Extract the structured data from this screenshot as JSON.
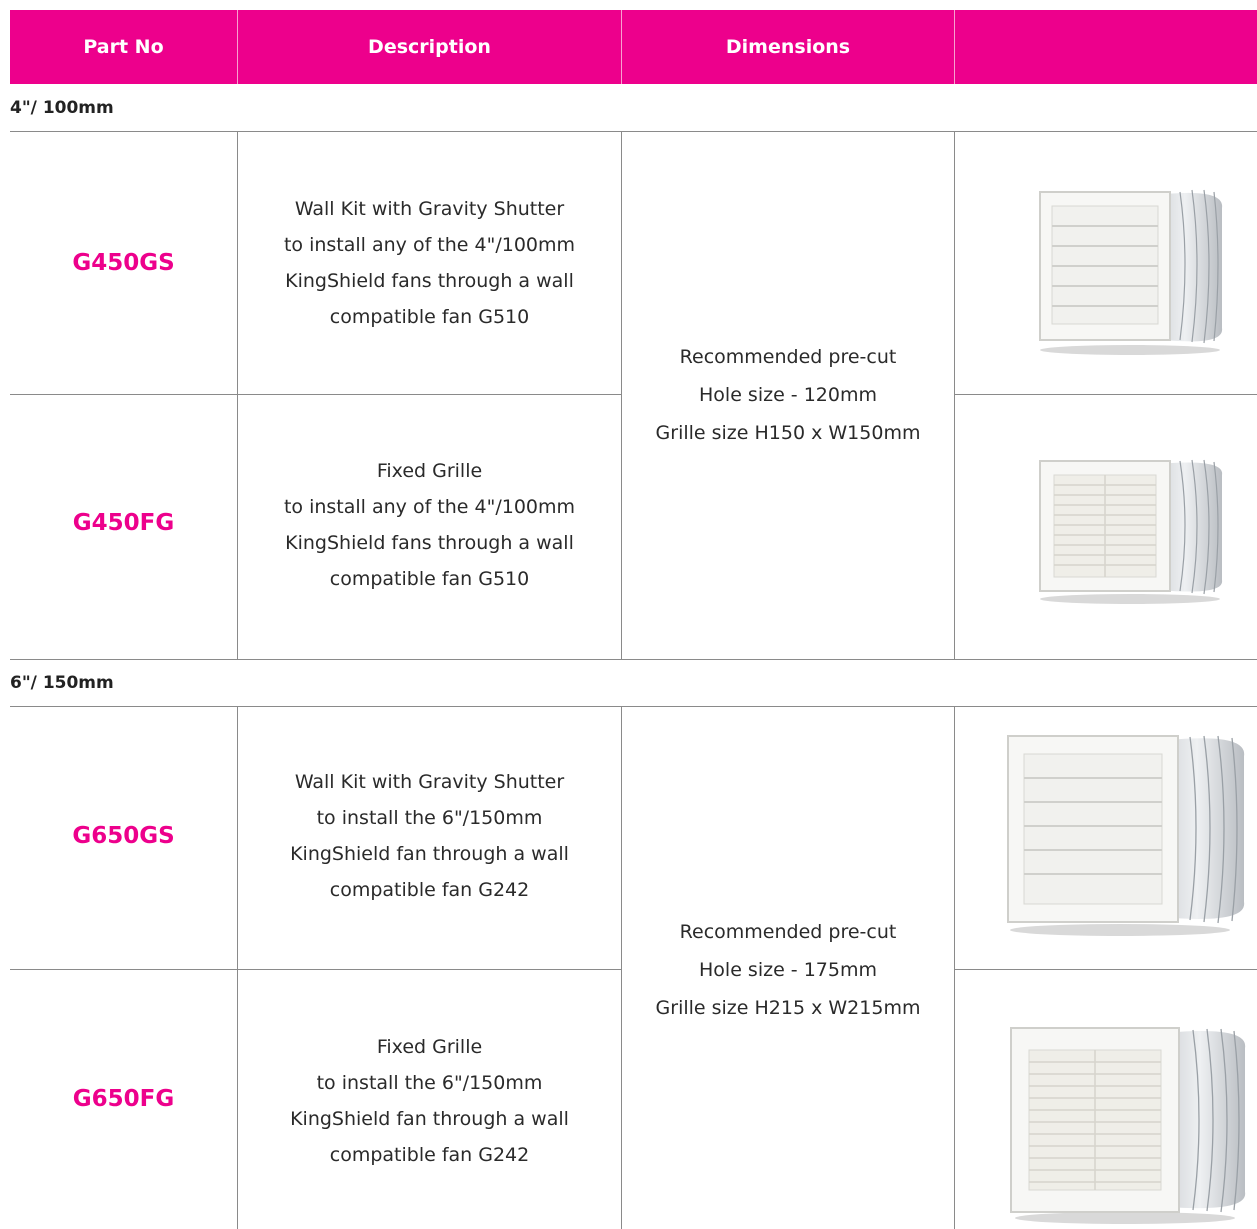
{
  "header": {
    "col_part": "Part No",
    "col_description": "Description",
    "col_dimensions": "Dimensions",
    "col_image": ""
  },
  "sections": [
    {
      "title": "4\"/ 100mm",
      "dimensions": [
        "Recommended pre-cut",
        "Hole size - 120mm",
        "Grille size H150 x W150mm"
      ],
      "rows": [
        {
          "part": "G450GS",
          "description": [
            "Wall Kit with Gravity Shutter",
            "to install any of the 4\"/100mm",
            "KingShield fans through a wall",
            "compatible fan G510"
          ],
          "image_icon": "wall-kit-gravity-shutter"
        },
        {
          "part": "G450FG",
          "description": [
            "Fixed Grille",
            "to install any of the 4\"/100mm",
            "KingShield fans through a wall",
            "compatible fan G510"
          ],
          "image_icon": "fixed-grille"
        }
      ]
    },
    {
      "title": "6\"/ 150mm",
      "dimensions": [
        "Recommended pre-cut",
        "Hole size - 175mm",
        "Grille size H215 x W215mm"
      ],
      "rows": [
        {
          "part": "G650GS",
          "description": [
            "Wall Kit with Gravity Shutter",
            "to install the 6\"/150mm",
            "KingShield fan through a wall",
            "compatible fan G242"
          ],
          "image_icon": "wall-kit-gravity-shutter"
        },
        {
          "part": "G650FG",
          "description": [
            "Fixed Grille",
            "to install the 6\"/150mm",
            "KingShield fan through a wall",
            "compatible fan G242"
          ],
          "image_icon": "fixed-grille"
        }
      ]
    }
  ],
  "colors": {
    "accent": "#ed008c",
    "grid": "#8a8a8a"
  }
}
